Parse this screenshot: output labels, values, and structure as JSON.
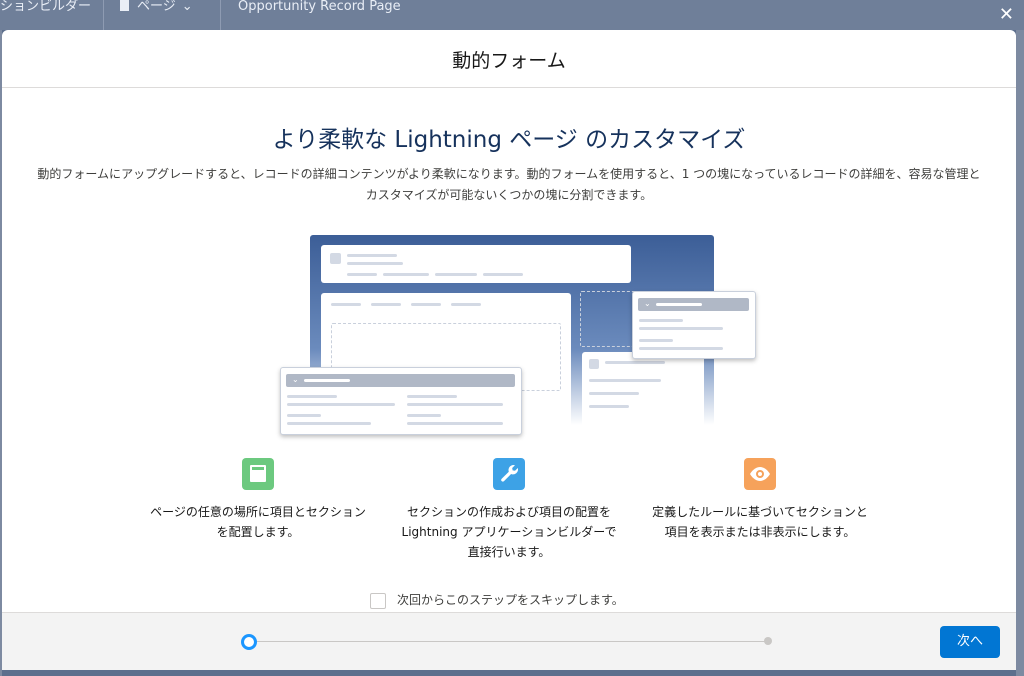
{
  "background": {
    "app_name": "ションビルダー",
    "page_menu": "ページ",
    "record_page": "Opportunity Record Page"
  },
  "modal": {
    "title": "動的フォーム",
    "hero_title": "より柔軟な Lightning ページ のカスタマイズ",
    "description": "動的フォームにアップグレードすると、レコードの詳細コンテンツがより柔軟になります。動的フォームを使用すると、1 つの塊になっているレコードの詳細を、容易な管理とカスタマイズが可能ないくつかの塊に分割できます。",
    "features": [
      {
        "icon": "layout-icon",
        "color": "#6cc97f",
        "text": "ページの任意の場所に項目とセクションを配置します。"
      },
      {
        "icon": "wrench-icon",
        "color": "#3da2e6",
        "text": "セクションの作成および項目の配置を Lightning アプリケーションビルダーで直接行います。"
      },
      {
        "icon": "eye-icon",
        "color": "#f6a25b",
        "text": "定義したルールに基づいてセクションと項目を表示または非表示にします。"
      }
    ],
    "skip_label": "次回からこのステップをスキップします。",
    "next_button": "次へ",
    "progress": {
      "current_step": 1,
      "total_steps": 2
    }
  },
  "colors": {
    "accent": "#0176d3",
    "progress_active": "#1b96ff"
  }
}
